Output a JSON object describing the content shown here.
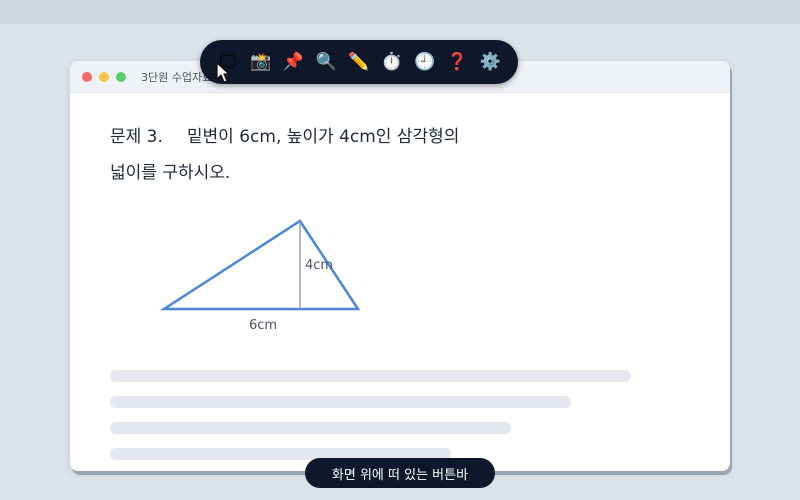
{
  "window": {
    "title": "3단원 수업자료",
    "problem": {
      "number": "문제 3.",
      "line1": "밑변이 6cm, 높이가 4cm인 삼각형의",
      "line2": "넓이를 구하시오."
    },
    "figure": {
      "shape": "triangle",
      "height_label": "4cm",
      "base_label": "6cm",
      "stroke_color": "#4a86d9",
      "height_line_color": "#9aa3ad"
    },
    "placeholder_lines": 4
  },
  "toolbar": {
    "background": "#0f172a",
    "tools": [
      {
        "name": "screen-icon",
        "glyph": "🖵"
      },
      {
        "name": "camera-icon",
        "glyph": "📸"
      },
      {
        "name": "pin-icon",
        "glyph": "📌"
      },
      {
        "name": "magnifier-icon",
        "glyph": "🔍"
      },
      {
        "name": "pencil-icon",
        "glyph": "✏️"
      },
      {
        "name": "stopwatch-icon",
        "glyph": "⏱️"
      },
      {
        "name": "clock-icon",
        "glyph": "🕘"
      },
      {
        "name": "question-icon",
        "glyph": "❓"
      },
      {
        "name": "gear-icon",
        "glyph": "⚙️"
      }
    ]
  },
  "floating_label": "화면 위에 떠 있는 버튼바"
}
